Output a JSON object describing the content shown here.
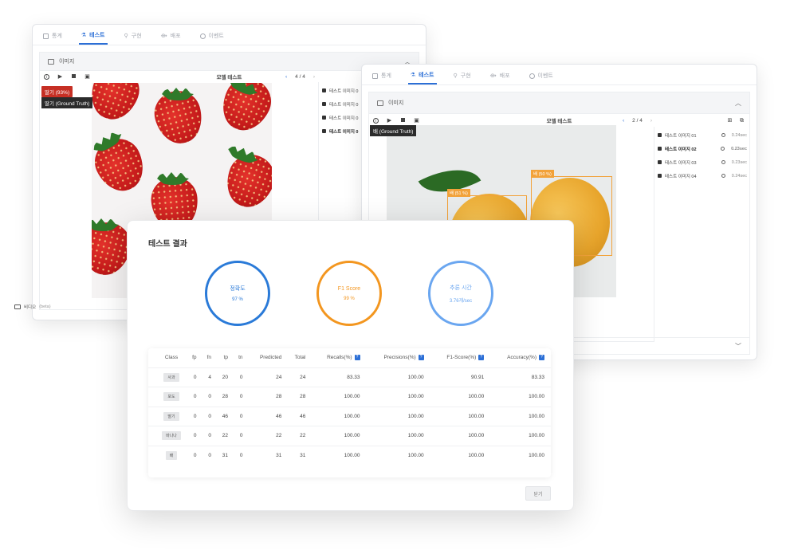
{
  "tabs": [
    {
      "label": "통계",
      "icon": "chart-icon"
    },
    {
      "label": "테스트",
      "icon": "flask-icon"
    },
    {
      "label": "구현",
      "icon": "pin-icon"
    },
    {
      "label": "배포",
      "icon": "deploy-icon"
    },
    {
      "label": "이벤트",
      "icon": "history-icon"
    }
  ],
  "section_label": "이미지",
  "toolbar_title": "모델 테스트",
  "window1": {
    "page": "4 / 4",
    "prediction_badge": "딸기 (93%)",
    "ground_truth_badge": "딸기 (Ground Truth)",
    "files": [
      {
        "name": "테스트 이미지 0"
      },
      {
        "name": "테스트 이미지 0"
      },
      {
        "name": "테스트 이미지 0"
      },
      {
        "name": "테스트 이미지 0",
        "bold": true
      }
    ],
    "video_label": "비디오",
    "video_beta": "(beta)"
  },
  "window2": {
    "page": "2 / 4",
    "ground_truth_badge": "배 (Ground Truth)",
    "detections": [
      "배 (51 %)",
      "배 (50 %)"
    ],
    "files": [
      {
        "name": "테스트 이미지 01",
        "time": "0.24sec"
      },
      {
        "name": "테스트 이미지 02",
        "time": "0.23sec"
      },
      {
        "name": "테스트 이미지 03",
        "time": "0.23sec"
      },
      {
        "name": "테스트 이미지 04",
        "time": "0.24sec"
      }
    ]
  },
  "dialog": {
    "title": "테스트 결과",
    "metrics": [
      {
        "label": "정확도",
        "value": "97 %",
        "color": "#2a7ad8"
      },
      {
        "label": "F1 Score",
        "value": "99 %",
        "color": "#f3961f"
      },
      {
        "label": "추론 시간",
        "value": "3.76개/sec",
        "color": "#6aa6f0"
      }
    ],
    "columns": [
      "Class",
      "fp",
      "fn",
      "tp",
      "tn",
      "Predicted",
      "Total",
      "Recalls(%)",
      "Precisions(%)",
      "F1-Score(%)",
      "Accuracy(%)"
    ],
    "rows": [
      [
        "사과",
        "0",
        "4",
        "20",
        "0",
        "24",
        "24",
        "83.33",
        "100.00",
        "90.91",
        "83.33"
      ],
      [
        "포도",
        "0",
        "0",
        "28",
        "0",
        "28",
        "28",
        "100.00",
        "100.00",
        "100.00",
        "100.00"
      ],
      [
        "딸기",
        "0",
        "0",
        "46",
        "0",
        "46",
        "46",
        "100.00",
        "100.00",
        "100.00",
        "100.00"
      ],
      [
        "바나나",
        "0",
        "0",
        "22",
        "0",
        "22",
        "22",
        "100.00",
        "100.00",
        "100.00",
        "100.00"
      ],
      [
        "배",
        "0",
        "0",
        "31",
        "0",
        "31",
        "31",
        "100.00",
        "100.00",
        "100.00",
        "100.00"
      ]
    ],
    "close_label": "닫기"
  }
}
